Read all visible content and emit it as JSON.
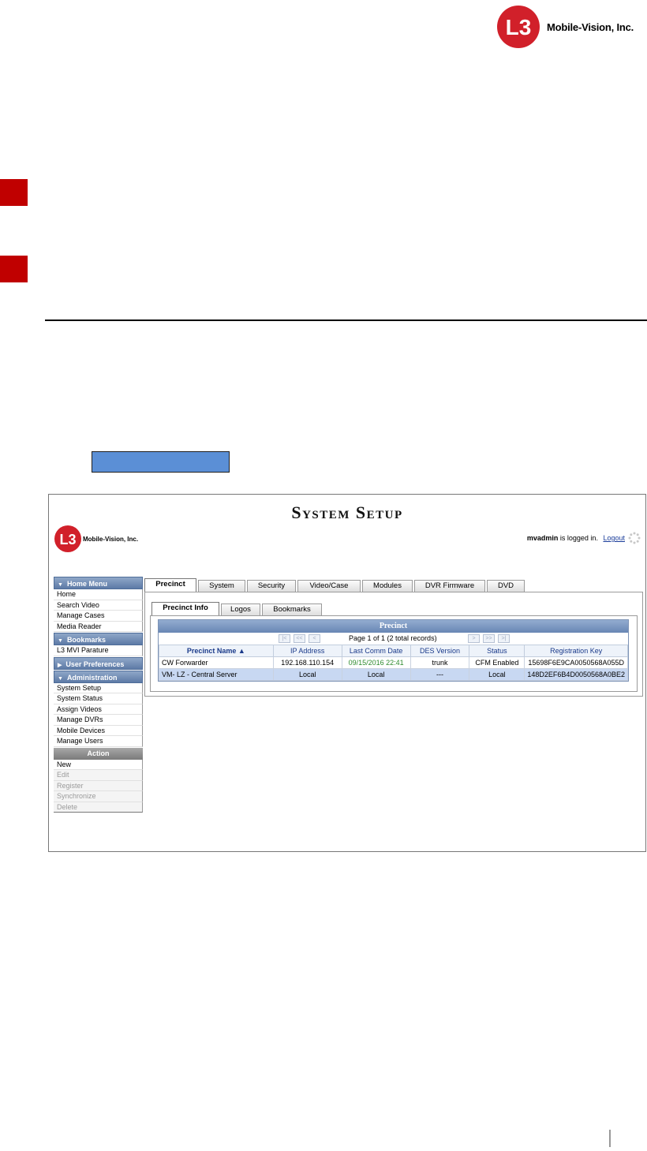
{
  "document": {
    "brand": "Mobile-Vision, Inc.",
    "logo_mark": "L3",
    "colors": {
      "red_tab": "#c00000",
      "blue_bar": "#5b8fd6"
    }
  },
  "app": {
    "title": "System Setup",
    "logo_mark": "L3",
    "brand": "Mobile-Vision, Inc.",
    "login": {
      "user": "mvadmin",
      "suffix": "is logged in.",
      "logout_label": "Logout"
    }
  },
  "sidebar": {
    "sections": [
      {
        "title": "Home Menu",
        "arrow": "▼",
        "items": [
          "Home",
          "Search Video",
          "Manage Cases",
          "Media Reader"
        ]
      },
      {
        "title": "Bookmarks",
        "arrow": "▼",
        "items": [
          "L3 MVI Parature"
        ]
      },
      {
        "title": "User Preferences",
        "arrow": "▶",
        "items": []
      },
      {
        "title": "Administration",
        "arrow": "▼",
        "items": [
          "System Setup",
          "System Status",
          "Assign Videos",
          "Manage DVRs",
          "Mobile Devices",
          "Manage Users"
        ]
      }
    ],
    "action": {
      "title": "Action",
      "items": [
        {
          "label": "New",
          "enabled": true
        },
        {
          "label": "Edit",
          "enabled": false
        },
        {
          "label": "Register",
          "enabled": false
        },
        {
          "label": "Synchronize",
          "enabled": false
        },
        {
          "label": "Delete",
          "enabled": false
        }
      ]
    }
  },
  "tabs": {
    "main": [
      "Precinct",
      "System",
      "Security",
      "Video/Case",
      "Modules",
      "DVR Firmware",
      "DVD"
    ],
    "active": "Precinct",
    "sub": [
      "Precinct Info",
      "Logos",
      "Bookmarks"
    ],
    "sub_active": "Precinct Info"
  },
  "precinct_table": {
    "caption": "Precinct",
    "pager_text": "Page 1 of 1 (2 total records)",
    "pager_buttons": {
      "first": "|<",
      "prev_block": "<<",
      "prev": "<",
      "next": ">",
      "next_block": ">>",
      "last": ">|"
    },
    "headers": [
      "Precinct Name ▲",
      "IP Address",
      "Last Comm Date",
      "DES Version",
      "Status",
      "Registration Key"
    ],
    "rows": [
      [
        "CW Forwarder",
        "192.168.110.154",
        "09/15/2016 22:41",
        "trunk",
        "CFM Enabled",
        "15698F6E9CA0050568A055D"
      ],
      [
        "VM- LZ - Central Server",
        "Local",
        "Local",
        "---",
        "Local",
        "148D2EF6B4D0050568A0BE2"
      ]
    ]
  }
}
